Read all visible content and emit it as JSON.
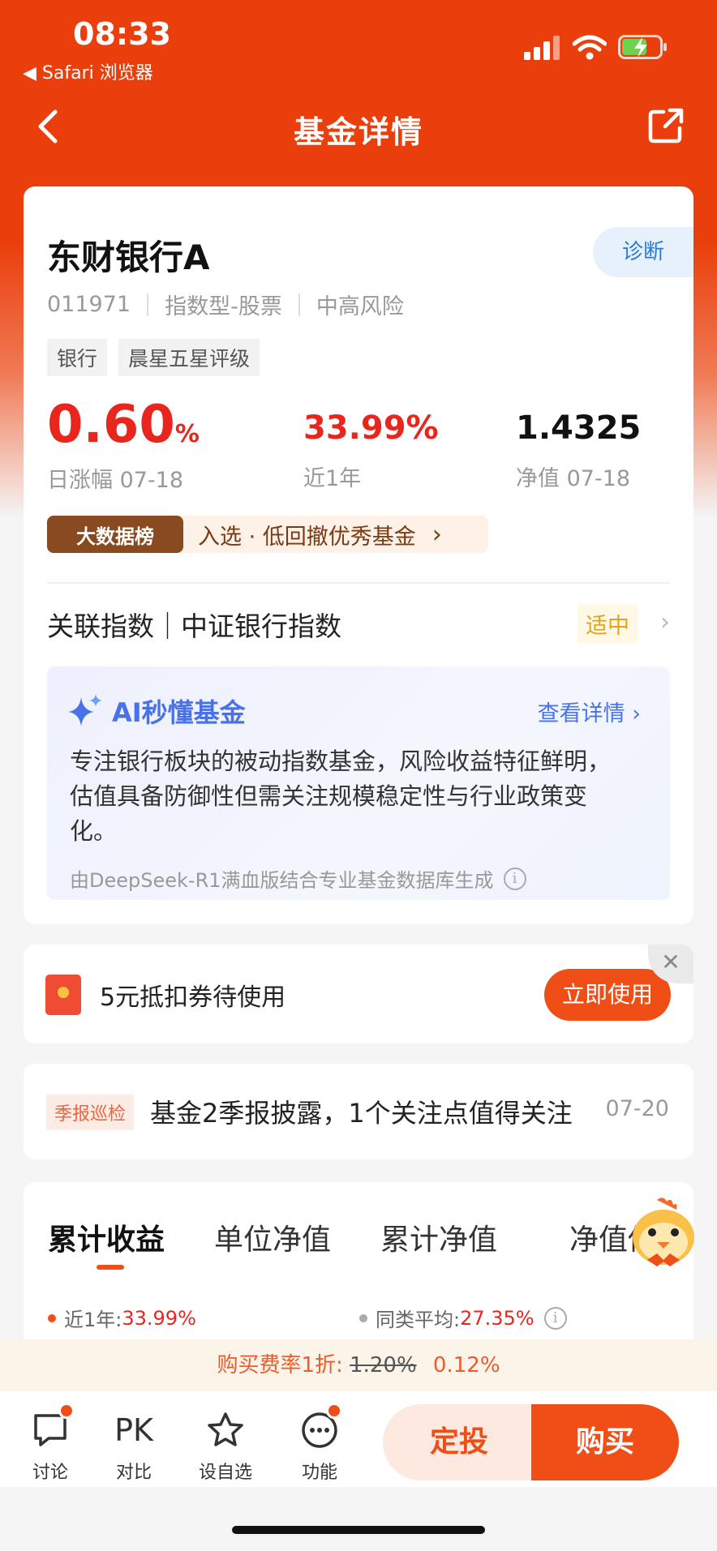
{
  "status": {
    "time": "08:33",
    "back_app": "◀ Safari 浏览器"
  },
  "nav": {
    "title": "基金详情"
  },
  "fund": {
    "name": "东财银行A",
    "diagnose_label": "诊断",
    "code": "011971",
    "type": "指数型-股票",
    "risk": "中高风险",
    "tags": [
      "银行",
      "晨星五星评级"
    ],
    "daily_change": "0.60",
    "daily_change_unit": "%",
    "daily_change_label": "日涨幅 07-18",
    "year_return": "33.99%",
    "year_return_label": "近1年",
    "nav_value": "1.4325",
    "nav_label": "净值 07-18",
    "colors": {
      "up": "#e8261e",
      "brand": "#ef4e16"
    }
  },
  "rank_banner": {
    "badge": "大数据榜",
    "text": "入选 · 低回撤优秀基金",
    "arrow": "›"
  },
  "related_index": {
    "text": "关联指数｜中证银行指数",
    "badge": "适中",
    "arrow": "›"
  },
  "ai": {
    "title": "AI秒懂基金",
    "more": "查看详情 ›",
    "body": "专注银行板块的被动指数基金，风险收益特征鲜明，估值具备防御性但需关注规模稳定性与行业政策变化。",
    "source": "由DeepSeek-R1满血版结合专业基金数据库生成",
    "info_icon": "i"
  },
  "coupon": {
    "text": "5元抵扣券待使用",
    "button": "立即使用",
    "close": "✕"
  },
  "report": {
    "badge": "季报巡检",
    "text": "基金2季报披露，1个关注点值得关注",
    "date": "07-20"
  },
  "chart_tabs": [
    "累计收益",
    "单位净值",
    "累计净值",
    "净值估算"
  ],
  "legend": {
    "own_label": "近1年:",
    "own_value": "33.99%",
    "avg_label": "同类平均:",
    "avg_value": "27.35%",
    "info_icon": "i"
  },
  "fee": {
    "label": "购买费率1折:",
    "original": "1.20%",
    "discounted": "0.12%"
  },
  "bottom": {
    "items": [
      {
        "label": "讨论",
        "icon": "chat-bubble-icon"
      },
      {
        "label": "对比",
        "icon": "PK"
      },
      {
        "label": "设自选",
        "icon": "star-icon"
      },
      {
        "label": "功能",
        "icon": "more-dots-icon"
      }
    ],
    "sip_label": "定投",
    "buy_label": "购买"
  }
}
